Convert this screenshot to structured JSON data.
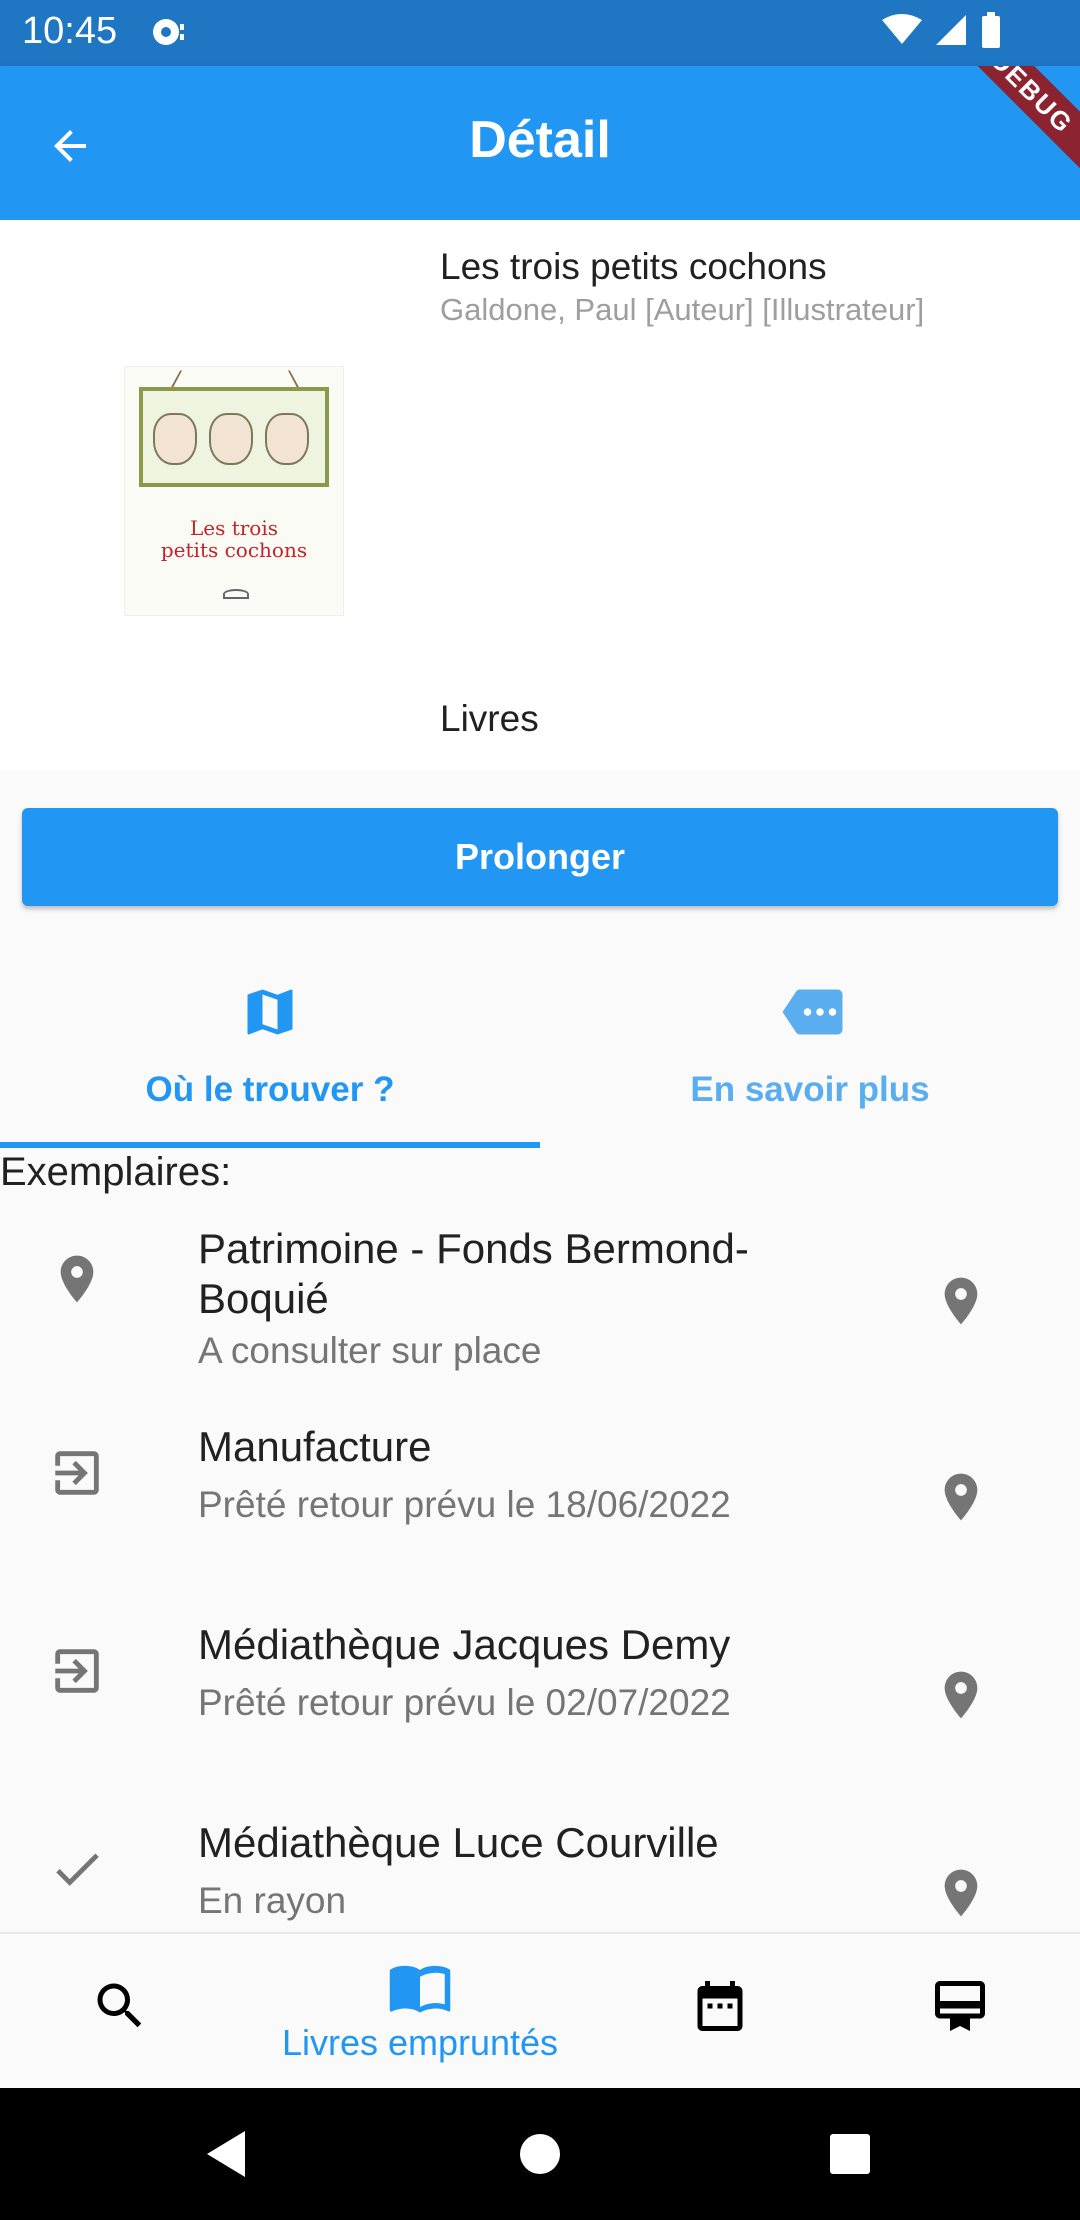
{
  "status_bar": {
    "time": "10:45"
  },
  "app_bar": {
    "title": "Détail",
    "debug_label": "DEBUG"
  },
  "book": {
    "title": "Les trois petits cochons",
    "author": "Galdone, Paul [Auteur] [Illustrateur]",
    "type": "Livres",
    "cover_title_line1": "Les trois",
    "cover_title_line2": "petits cochons"
  },
  "actions": {
    "prolonger_label": "Prolonger"
  },
  "tabs": [
    {
      "label": "Où le trouver ?",
      "icon": "map-icon",
      "selected": true
    },
    {
      "label": "En savoir plus",
      "icon": "more-label-icon",
      "selected": false
    }
  ],
  "copies_section": {
    "label": "Exemplaires:"
  },
  "copies": [
    {
      "icon": "location-pin-icon",
      "title": "Patrimoine - Fonds Bermond-Boquié",
      "status": "A consulter sur place"
    },
    {
      "icon": "exit-to-app-icon",
      "title": "Manufacture",
      "status": "Prêté retour prévu le 18/06/2022"
    },
    {
      "icon": "exit-to-app-icon",
      "title": "Médiathèque Jacques Demy",
      "status": "Prêté retour prévu le 02/07/2022"
    },
    {
      "icon": "check-icon",
      "title": "Médiathèque Luce Courville",
      "status": "En rayon"
    }
  ],
  "bottom_nav": {
    "items": [
      {
        "icon": "search-icon",
        "label": ""
      },
      {
        "icon": "open-book-icon",
        "label": "Livres empruntés"
      },
      {
        "icon": "calendar-icon",
        "label": ""
      },
      {
        "icon": "card-membership-icon",
        "label": ""
      }
    ]
  },
  "colors": {
    "primary": "#2196f3",
    "status_bar": "#1f76c2",
    "debug_ribbon": "#8b2430"
  }
}
